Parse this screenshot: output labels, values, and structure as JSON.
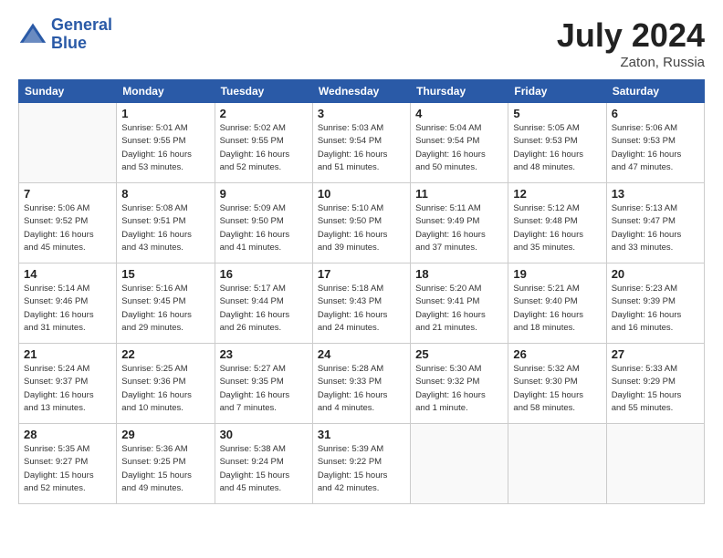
{
  "header": {
    "logo_line1": "General",
    "logo_line2": "Blue",
    "month_year": "July 2024",
    "location": "Zaton, Russia"
  },
  "days_of_week": [
    "Sunday",
    "Monday",
    "Tuesday",
    "Wednesday",
    "Thursday",
    "Friday",
    "Saturday"
  ],
  "weeks": [
    [
      {
        "num": "",
        "info": ""
      },
      {
        "num": "1",
        "info": "Sunrise: 5:01 AM\nSunset: 9:55 PM\nDaylight: 16 hours\nand 53 minutes."
      },
      {
        "num": "2",
        "info": "Sunrise: 5:02 AM\nSunset: 9:55 PM\nDaylight: 16 hours\nand 52 minutes."
      },
      {
        "num": "3",
        "info": "Sunrise: 5:03 AM\nSunset: 9:54 PM\nDaylight: 16 hours\nand 51 minutes."
      },
      {
        "num": "4",
        "info": "Sunrise: 5:04 AM\nSunset: 9:54 PM\nDaylight: 16 hours\nand 50 minutes."
      },
      {
        "num": "5",
        "info": "Sunrise: 5:05 AM\nSunset: 9:53 PM\nDaylight: 16 hours\nand 48 minutes."
      },
      {
        "num": "6",
        "info": "Sunrise: 5:06 AM\nSunset: 9:53 PM\nDaylight: 16 hours\nand 47 minutes."
      }
    ],
    [
      {
        "num": "7",
        "info": "Sunrise: 5:06 AM\nSunset: 9:52 PM\nDaylight: 16 hours\nand 45 minutes."
      },
      {
        "num": "8",
        "info": "Sunrise: 5:08 AM\nSunset: 9:51 PM\nDaylight: 16 hours\nand 43 minutes."
      },
      {
        "num": "9",
        "info": "Sunrise: 5:09 AM\nSunset: 9:50 PM\nDaylight: 16 hours\nand 41 minutes."
      },
      {
        "num": "10",
        "info": "Sunrise: 5:10 AM\nSunset: 9:50 PM\nDaylight: 16 hours\nand 39 minutes."
      },
      {
        "num": "11",
        "info": "Sunrise: 5:11 AM\nSunset: 9:49 PM\nDaylight: 16 hours\nand 37 minutes."
      },
      {
        "num": "12",
        "info": "Sunrise: 5:12 AM\nSunset: 9:48 PM\nDaylight: 16 hours\nand 35 minutes."
      },
      {
        "num": "13",
        "info": "Sunrise: 5:13 AM\nSunset: 9:47 PM\nDaylight: 16 hours\nand 33 minutes."
      }
    ],
    [
      {
        "num": "14",
        "info": "Sunrise: 5:14 AM\nSunset: 9:46 PM\nDaylight: 16 hours\nand 31 minutes."
      },
      {
        "num": "15",
        "info": "Sunrise: 5:16 AM\nSunset: 9:45 PM\nDaylight: 16 hours\nand 29 minutes."
      },
      {
        "num": "16",
        "info": "Sunrise: 5:17 AM\nSunset: 9:44 PM\nDaylight: 16 hours\nand 26 minutes."
      },
      {
        "num": "17",
        "info": "Sunrise: 5:18 AM\nSunset: 9:43 PM\nDaylight: 16 hours\nand 24 minutes."
      },
      {
        "num": "18",
        "info": "Sunrise: 5:20 AM\nSunset: 9:41 PM\nDaylight: 16 hours\nand 21 minutes."
      },
      {
        "num": "19",
        "info": "Sunrise: 5:21 AM\nSunset: 9:40 PM\nDaylight: 16 hours\nand 18 minutes."
      },
      {
        "num": "20",
        "info": "Sunrise: 5:23 AM\nSunset: 9:39 PM\nDaylight: 16 hours\nand 16 minutes."
      }
    ],
    [
      {
        "num": "21",
        "info": "Sunrise: 5:24 AM\nSunset: 9:37 PM\nDaylight: 16 hours\nand 13 minutes."
      },
      {
        "num": "22",
        "info": "Sunrise: 5:25 AM\nSunset: 9:36 PM\nDaylight: 16 hours\nand 10 minutes."
      },
      {
        "num": "23",
        "info": "Sunrise: 5:27 AM\nSunset: 9:35 PM\nDaylight: 16 hours\nand 7 minutes."
      },
      {
        "num": "24",
        "info": "Sunrise: 5:28 AM\nSunset: 9:33 PM\nDaylight: 16 hours\nand 4 minutes."
      },
      {
        "num": "25",
        "info": "Sunrise: 5:30 AM\nSunset: 9:32 PM\nDaylight: 16 hours\nand 1 minute."
      },
      {
        "num": "26",
        "info": "Sunrise: 5:32 AM\nSunset: 9:30 PM\nDaylight: 15 hours\nand 58 minutes."
      },
      {
        "num": "27",
        "info": "Sunrise: 5:33 AM\nSunset: 9:29 PM\nDaylight: 15 hours\nand 55 minutes."
      }
    ],
    [
      {
        "num": "28",
        "info": "Sunrise: 5:35 AM\nSunset: 9:27 PM\nDaylight: 15 hours\nand 52 minutes."
      },
      {
        "num": "29",
        "info": "Sunrise: 5:36 AM\nSunset: 9:25 PM\nDaylight: 15 hours\nand 49 minutes."
      },
      {
        "num": "30",
        "info": "Sunrise: 5:38 AM\nSunset: 9:24 PM\nDaylight: 15 hours\nand 45 minutes."
      },
      {
        "num": "31",
        "info": "Sunrise: 5:39 AM\nSunset: 9:22 PM\nDaylight: 15 hours\nand 42 minutes."
      },
      {
        "num": "",
        "info": ""
      },
      {
        "num": "",
        "info": ""
      },
      {
        "num": "",
        "info": ""
      }
    ]
  ]
}
